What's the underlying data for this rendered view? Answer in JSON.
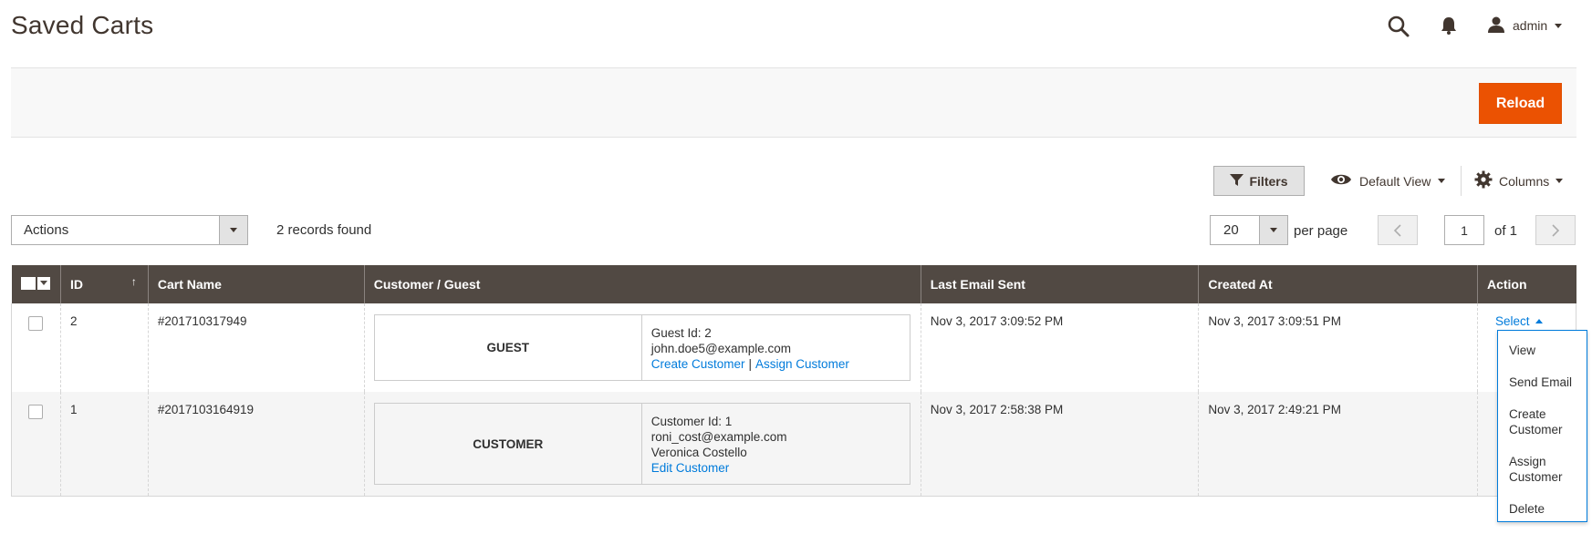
{
  "header": {
    "title": "Saved Carts",
    "user": "admin"
  },
  "action_bar": {
    "reload_label": "Reload"
  },
  "toolbar": {
    "filters_label": "Filters",
    "view_label": "Default View",
    "columns_label": "Columns",
    "actions_label": "Actions",
    "records_found": "2 records found",
    "per_page_value": "20",
    "per_page_label": "per page",
    "page_value": "1",
    "page_of": "of 1"
  },
  "grid": {
    "columns": [
      "ID",
      "Cart Name",
      "Customer / Guest",
      "Last Email Sent",
      "Created At",
      "Action"
    ],
    "rows": [
      {
        "id": "2",
        "cart_name": "#201710317949",
        "type": "GUEST",
        "info_line1": "Guest Id: 2",
        "info_line2": "john.doe5@example.com",
        "link1": "Create Customer",
        "link_sep": "|",
        "link2": "Assign Customer",
        "last_email": "Nov 3, 2017 3:09:52 PM",
        "created_at": "Nov 3, 2017 3:09:51 PM",
        "action": "Select"
      },
      {
        "id": "1",
        "cart_name": "#2017103164919",
        "type": "CUSTOMER",
        "info_line1": "Customer Id: 1",
        "info_line2": "roni_cost@example.com",
        "info_line3": "Veronica Costello",
        "link1": "Edit Customer",
        "last_email": "Nov 3, 2017 2:58:38 PM",
        "created_at": "Nov 3, 2017 2:49:21 PM"
      }
    ]
  },
  "action_menu": {
    "items": [
      "View",
      "Send Email",
      "Create Customer",
      "Assign Customer",
      "Delete"
    ]
  },
  "colors": {
    "accent": "#eb5202",
    "header_bg": "#514943",
    "link": "#007bdb"
  },
  "icons": {
    "search": "search-icon",
    "bell": "bell-icon",
    "user": "user-icon",
    "filter": "filter-icon",
    "eye": "eye-icon",
    "gear": "gear-icon"
  }
}
